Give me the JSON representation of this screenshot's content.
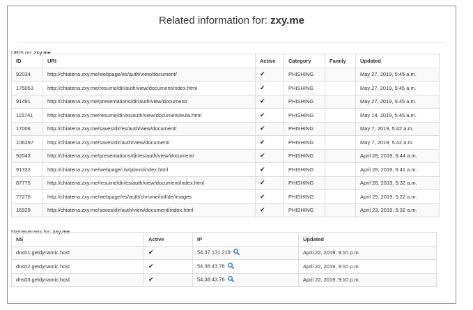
{
  "title_prefix": "Related information for: ",
  "domain": "zxy.me",
  "uris_label_prefix": "URIS on: ",
  "ns_label_prefix": "Nameservers for: ",
  "uris_table": {
    "headers": [
      "ID",
      "URI",
      "Active",
      "Category",
      "Family",
      "Updated"
    ],
    "rows": [
      {
        "id": "92034",
        "uri": "http://chiatena.zxy.me/webpage/es/auth/view/document/",
        "active": "✔",
        "category": "PHISHING",
        "family": "",
        "updated": "May 27, 2019, 5:45 a.m."
      },
      {
        "id": "175053",
        "uri": "http://chiatena.zxy.me/resume/dir/auth/view/document/index.html",
        "active": "✔",
        "category": "PHISHING",
        "family": "",
        "updated": "May 27, 2019, 5:45 a.m."
      },
      {
        "id": "91491",
        "uri": "http://chiatena.zxy.me/presentations/dir/auth/view/document/",
        "active": "✔",
        "category": "PHISHING",
        "family": "",
        "updated": "May 27, 2019, 5:45 a.m."
      },
      {
        "id": "115741",
        "uri": "http://chiatena.zxy.me/resume/dir/es/auth/view/document/eula.html",
        "active": "✔",
        "category": "PHISHING",
        "family": "",
        "updated": "May 14, 2019, 5:45 a.m."
      },
      {
        "id": "17006",
        "uri": "http://chiatena.zxy.me/saves/dir/es/auth/view/document/",
        "active": "✔",
        "category": "PHISHING",
        "family": "",
        "updated": "May 7, 2019, 5:42 a.m."
      },
      {
        "id": "106297",
        "uri": "http://chiatena.zxy.me/saves/dir/auth/view/document/",
        "active": "✔",
        "category": "PHISHING",
        "family": "",
        "updated": "May 7, 2019, 5:42 a.m."
      },
      {
        "id": "92043",
        "uri": "http://chiatena.zxy.me/presentations/dir/es/auth/view/document/",
        "active": "✔",
        "category": "PHISHING",
        "family": "",
        "updated": "April 28, 2019, 6:44 a.m."
      },
      {
        "id": "91332",
        "uri": "http://chiatena.zxy.me/webpage/-/w/plans/index.html",
        "active": "✔",
        "category": "PHISHING",
        "family": "",
        "updated": "April 28, 2019, 6:41 a.m."
      },
      {
        "id": "87775",
        "uri": "http://chiatena.zxy.me/resume/dir/es/auth/view/document/index.html",
        "active": "✔",
        "category": "PHISHING",
        "family": "",
        "updated": "April 26, 2019, 5:32 a.m."
      },
      {
        "id": "77275",
        "uri": "http://chiatena.zxy.me/webpage/es/auth/chrome/intl/de/images",
        "active": "✔",
        "category": "PHISHING",
        "family": "",
        "updated": "April 25, 2019, 5:22 a.m."
      },
      {
        "id": "16929",
        "uri": "http://chiatena.zxy.me/saves/dir/auth/view/document/index.html",
        "active": "✔",
        "category": "PHISHING",
        "family": "",
        "updated": "April 23, 2019, 5:32 a.m."
      }
    ]
  },
  "ns_table": {
    "headers": [
      "NS",
      "Active",
      "IP",
      "Updated"
    ],
    "rows": [
      {
        "ns": "dns01.getdynamic.host",
        "active": "✔",
        "ip": "54.37.131.219",
        "updated": "April 22, 2019, 9:10 p.m."
      },
      {
        "ns": "dns02.getdynamic.host",
        "active": "✔",
        "ip": "54.38.43.76",
        "updated": "April 22, 2019, 9:10 p.m."
      },
      {
        "ns": "dns03.getdynamic.host",
        "active": "✔",
        "ip": "54.38.43.76",
        "updated": "April 22, 2019, 9:10 p.m."
      }
    ]
  },
  "icons": {
    "search": "magnifier-icon"
  },
  "colors": {
    "search_icon": "#2a7fc1",
    "border": "#dddddd",
    "stripe": "#f9f9f9"
  }
}
